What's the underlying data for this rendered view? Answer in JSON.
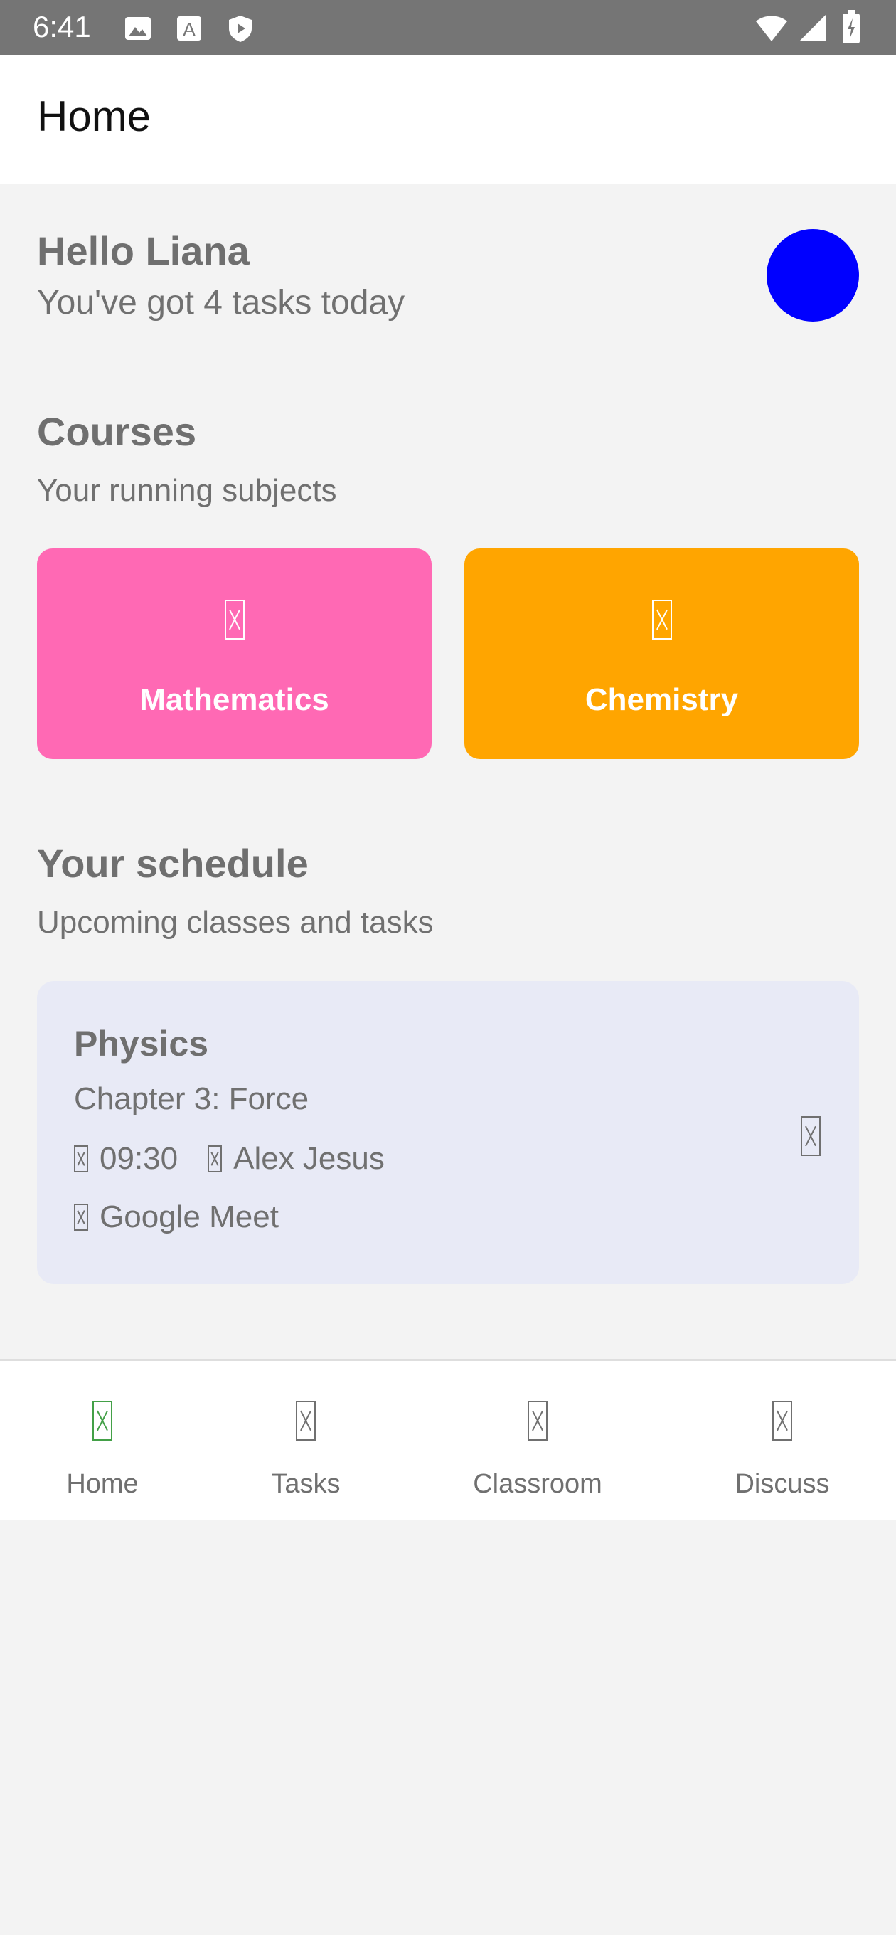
{
  "status_bar": {
    "time": "6:41",
    "left_icons": [
      "image-icon",
      "font-icon",
      "shield-play-icon"
    ],
    "right_icons": [
      "wifi-icon",
      "cell-signal-icon",
      "battery-icon"
    ]
  },
  "app_bar": {
    "title": "Home"
  },
  "greeting": {
    "title": "Hello Liana",
    "subtitle": "You've got 4 tasks today",
    "avatar_color": "#0000ff"
  },
  "courses": {
    "title": "Courses",
    "subtitle": "Your running subjects",
    "items": [
      {
        "label": "Mathematics",
        "color": "#ff69b4",
        "icon": "course-icon"
      },
      {
        "label": "Chemistry",
        "color": "#ffa500",
        "icon": "course-icon"
      }
    ]
  },
  "schedule": {
    "title": "Your schedule",
    "subtitle": "Upcoming classes and tasks",
    "card": {
      "subject": "Physics",
      "chapter": "Chapter 3: Force",
      "time": "09:30",
      "teacher": "Alex Jesus",
      "platform": "Google Meet",
      "background": "#e8eaf6"
    }
  },
  "bottom_nav": {
    "items": [
      {
        "label": "Home",
        "active": true
      },
      {
        "label": "Tasks",
        "active": false
      },
      {
        "label": "Classroom",
        "active": false
      },
      {
        "label": "Discuss",
        "active": false
      }
    ],
    "active_color": "#43a047"
  }
}
